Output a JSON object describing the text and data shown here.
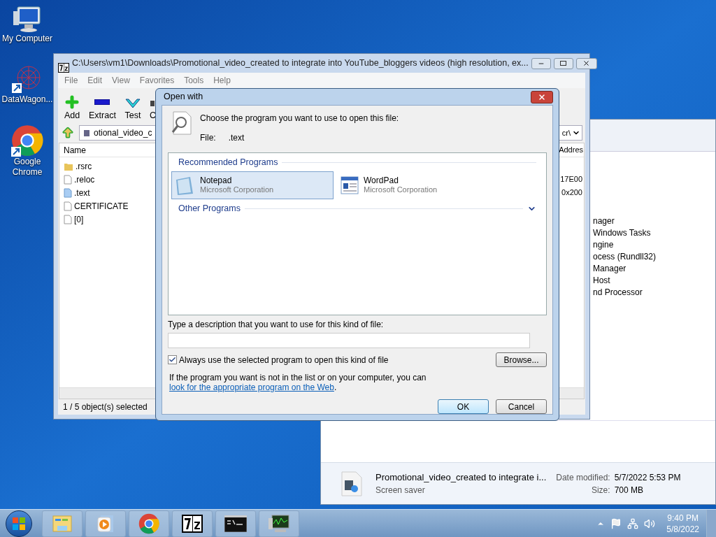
{
  "desktop_icons": [
    {
      "label": "My Computer",
      "kind": "computer"
    },
    {
      "label": "DataWagon...",
      "kind": "network"
    },
    {
      "label": "Google Chrome",
      "kind": "chrome"
    }
  ],
  "explorer": {
    "list_items": [
      "nager",
      "Windows Tasks",
      "ngine",
      "ocess (Rundll32)",
      "Manager",
      "Host",
      "nd Processor"
    ],
    "details": {
      "file_name": "Promotional_video_created to integrate i...",
      "file_type": "Screen saver",
      "date_label": "Date modified:",
      "date_value": "5/7/2022 5:53 PM",
      "size_label": "Size:",
      "size_value": "700 MB"
    }
  },
  "archive_window": {
    "title": "C:\\Users\\vm1\\Downloads\\Promotional_video_created to integrate into YouTube_bloggers videos (high resolution, ex...",
    "menu": [
      "File",
      "Edit",
      "View",
      "Favorites",
      "Tools",
      "Help"
    ],
    "toolbar": [
      {
        "label": "Add",
        "kind": "add"
      },
      {
        "label": "Extract",
        "kind": "extract"
      },
      {
        "label": "Test",
        "kind": "test"
      },
      {
        "label": "C",
        "kind": "copy"
      }
    ],
    "path_start": "otional_video_c",
    "path_end": "cr\\",
    "columns": [
      "Name",
      "Addres"
    ],
    "rows": [
      {
        "name": ".rsrc",
        "kind": "folder"
      },
      {
        "name": ".reloc",
        "kind": "file",
        "address": "17E00"
      },
      {
        "name": ".text",
        "kind": "code",
        "address": "0x200"
      },
      {
        "name": "CERTIFICATE",
        "kind": "file"
      },
      {
        "name": "[0]",
        "kind": "file"
      }
    ],
    "status": "1 / 5 object(s) selected"
  },
  "dialog": {
    "title": "Open with",
    "prompt": "Choose the program you want to use to open this file:",
    "file_label": "File:",
    "file_name": ".text",
    "groups": [
      {
        "label": "Recommended Programs",
        "expanded": true,
        "programs": [
          {
            "name": "Notepad",
            "publisher": "Microsoft Corporation",
            "kind": "notepad",
            "selected": true
          },
          {
            "name": "WordPad",
            "publisher": "Microsoft Corporation",
            "kind": "wordpad",
            "selected": false
          }
        ]
      },
      {
        "label": "Other Programs",
        "expanded": false
      }
    ],
    "description_label": "Type a description that you want to use for this kind of file:",
    "always_use": {
      "label": "Always use the selected program to open this kind of file",
      "checked": true
    },
    "browse": "Browse...",
    "help_text": "If the program you want is not in the list or on your computer, you can",
    "help_link": "look for the appropriate program on the Web",
    "help_end": ".",
    "ok": "OK",
    "cancel": "Cancel"
  },
  "taskbar": {
    "apps": [
      {
        "kind": "explorer"
      },
      {
        "kind": "media"
      },
      {
        "kind": "chrome"
      },
      {
        "kind": "sevenzip"
      },
      {
        "kind": "console"
      },
      {
        "kind": "monitor"
      }
    ],
    "time": "9:40 PM",
    "date": "5/8/2022"
  }
}
